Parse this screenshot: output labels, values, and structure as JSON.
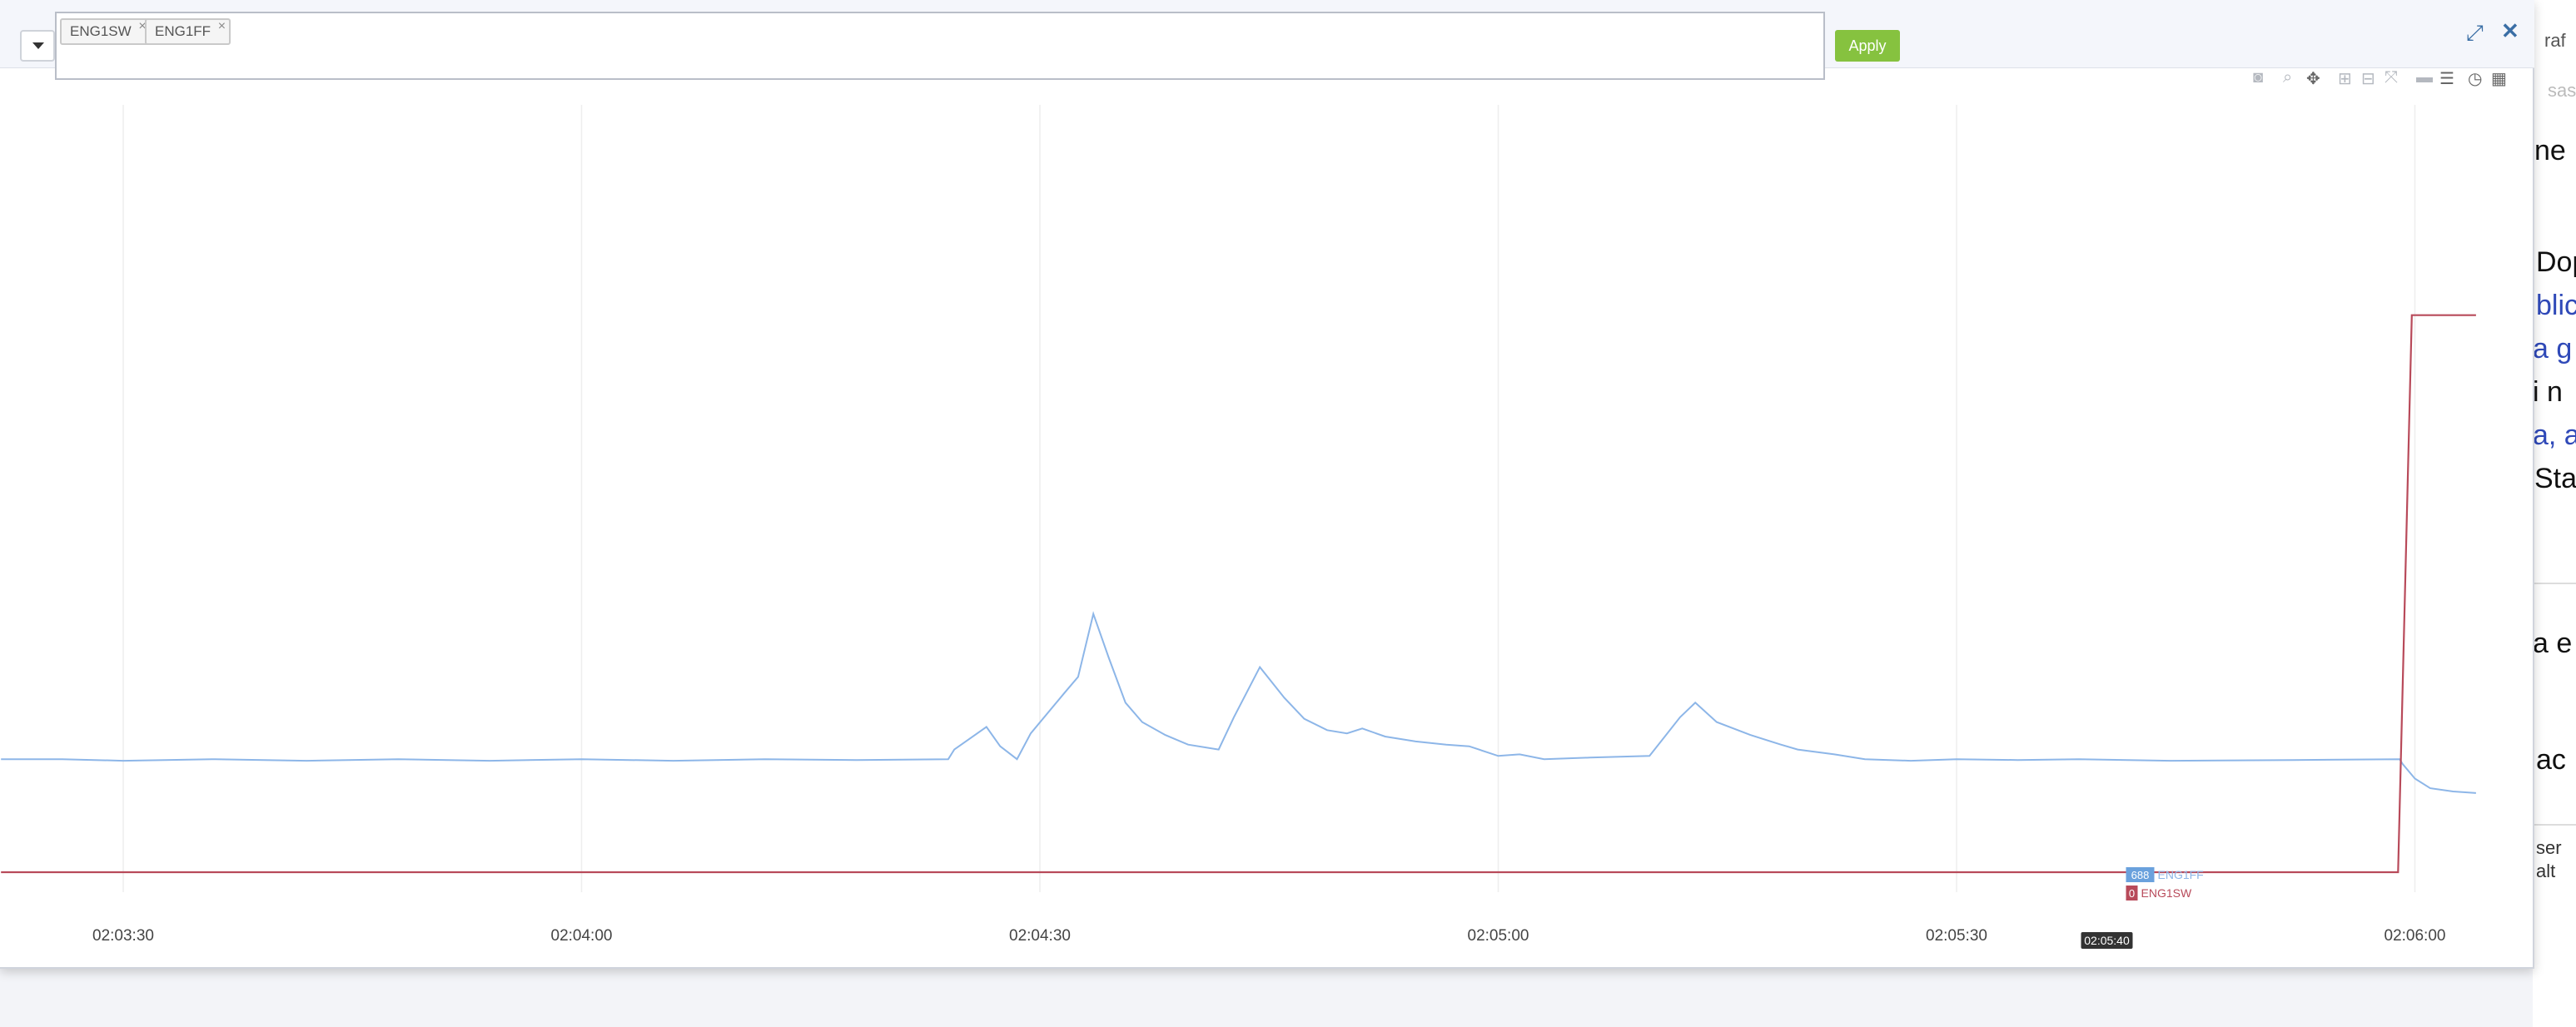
{
  "filter": {
    "tags": [
      "ENG1SW",
      "ENG1FF"
    ],
    "tag_remove_glyph": "×",
    "apply_label": "Apply"
  },
  "header": {
    "collapse_icon": "chevron-down-icon",
    "expand_icon": "expand-icon",
    "close_icon": "close-icon"
  },
  "modebar": {
    "icons": [
      "camera-icon",
      "zoom-icon",
      "pan-icon",
      "zoom-in-icon",
      "zoom-out-icon",
      "autoscale-icon",
      "spike-line-icon",
      "compare-icon",
      "reset-icon",
      "toggle-icon"
    ]
  },
  "background_page": {
    "fragments": [
      "raf",
      "sas",
      "ne",
      "Dop",
      "blic",
      "a g",
      "i n",
      "a, a",
      "Sta",
      "a e",
      "ac",
      "ser",
      "alt"
    ]
  },
  "colors": {
    "series_eng1ff": "#8db6e8",
    "series_eng1sw": "#b84a5a",
    "apply": "#86c23f",
    "header_icons": "#3a6ea5"
  },
  "chart_data": {
    "type": "line",
    "x_ticks": [
      "02:03:30",
      "02:04:00",
      "02:04:30",
      "02:05:00",
      "02:05:30",
      "02:06:00"
    ],
    "xlim_seconds": [
      -8,
      84
    ],
    "ylim": [
      0,
      4000
    ],
    "grid": true,
    "hover": {
      "time_label": "02:05:40",
      "points": [
        {
          "series": "ENG1FF",
          "value": "688"
        },
        {
          "series": "ENG1SW",
          "value": "0"
        }
      ]
    },
    "series": [
      {
        "name": "ENG1FF",
        "points": [
          [
            -8,
            700
          ],
          [
            -4,
            700
          ],
          [
            0,
            690
          ],
          [
            6,
            700
          ],
          [
            12,
            690
          ],
          [
            18,
            700
          ],
          [
            24,
            690
          ],
          [
            30,
            700
          ],
          [
            36,
            690
          ],
          [
            42,
            700
          ],
          [
            48,
            695
          ],
          [
            54,
            700
          ],
          [
            54.4,
            760
          ],
          [
            56.5,
            900
          ],
          [
            57.4,
            780
          ],
          [
            58.5,
            700
          ],
          [
            59.4,
            860
          ],
          [
            61.6,
            1110
          ],
          [
            62.5,
            1210
          ],
          [
            63.5,
            1600
          ],
          [
            64.5,
            1330
          ],
          [
            65.6,
            1050
          ],
          [
            66.7,
            930
          ],
          [
            68.2,
            850
          ],
          [
            69.7,
            790
          ],
          [
            71.7,
            760
          ],
          [
            72.7,
            960
          ],
          [
            74.4,
            1270
          ],
          [
            76,
            1080
          ],
          [
            77.3,
            950
          ],
          [
            78.8,
            880
          ],
          [
            80.1,
            860
          ],
          [
            81.1,
            890
          ],
          [
            82.6,
            840
          ],
          [
            84.6,
            810
          ],
          [
            86.6,
            790
          ],
          [
            88.1,
            780
          ],
          [
            90,
            720
          ],
          [
            91.4,
            730
          ],
          [
            93,
            700
          ],
          [
            96,
            710
          ],
          [
            99.9,
            720
          ],
          [
            101.9,
            960
          ],
          [
            102.9,
            1050
          ],
          [
            104.3,
            930
          ],
          [
            106.5,
            850
          ],
          [
            108.5,
            790
          ],
          [
            109.6,
            760
          ],
          [
            112,
            730
          ],
          [
            114,
            700
          ],
          [
            117,
            690
          ],
          [
            120,
            700
          ],
          [
            124,
            695
          ],
          [
            128,
            700
          ],
          [
            134,
            690
          ],
          [
            142,
            695
          ],
          [
            149,
            700
          ],
          [
            149.2,
            670
          ],
          [
            150,
            580
          ],
          [
            151,
            520
          ],
          [
            152.5,
            500
          ],
          [
            154,
            490
          ]
        ],
        "display_note": ""
      },
      {
        "name": "ENG1SW",
        "points": [
          [
            -8,
            0
          ],
          [
            148.9,
            0
          ],
          [
            149.8,
            3450
          ],
          [
            154,
            3450
          ]
        ]
      }
    ]
  }
}
